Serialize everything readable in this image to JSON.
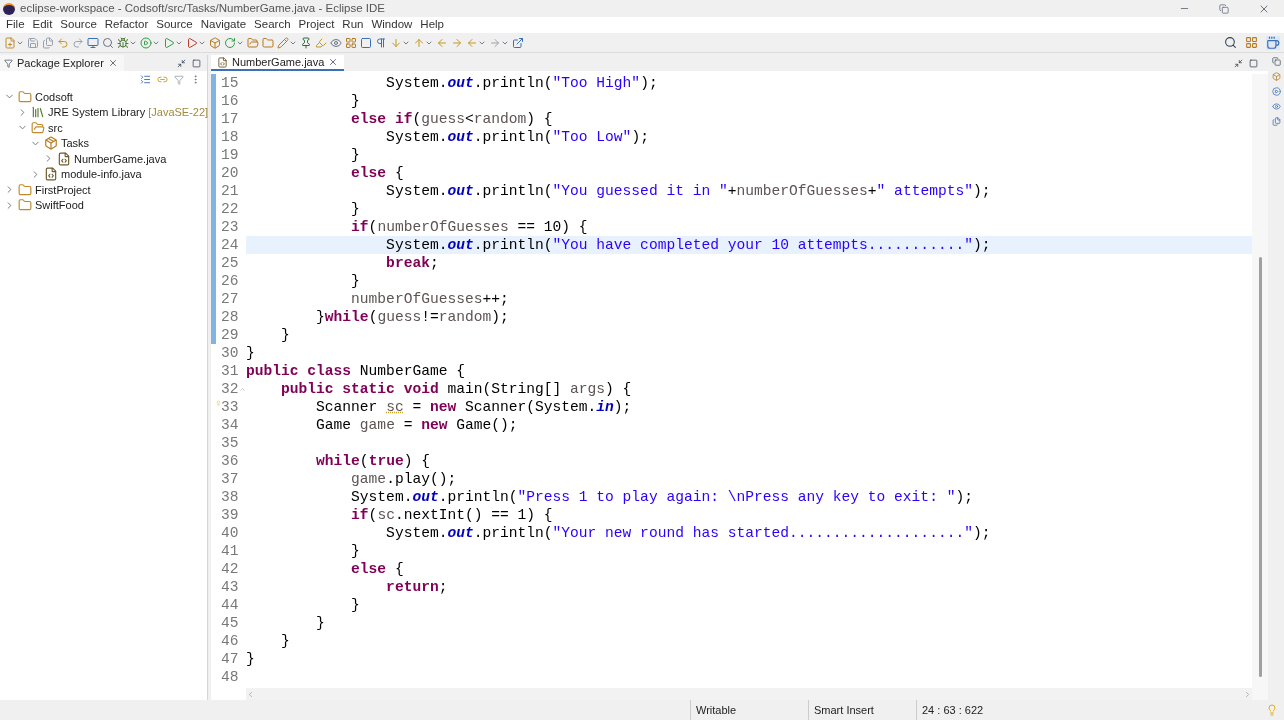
{
  "window": {
    "title": "eclipse-workspace - Codsoft/src/Tasks/NumberGame.java - Eclipse IDE"
  },
  "menu": [
    "File",
    "Edit",
    "Source",
    "Refactor",
    "Source",
    "Navigate",
    "Search",
    "Project",
    "Run",
    "Window",
    "Help"
  ],
  "explorer": {
    "title": "Package Explorer",
    "tree": [
      {
        "label": "Codsoft",
        "kind": "project",
        "expanded": true,
        "children": [
          {
            "label": "JRE System Library",
            "decoration": "[JavaSE-22]",
            "kind": "library",
            "expanded": false
          },
          {
            "label": "src",
            "kind": "folder",
            "expanded": true,
            "children": [
              {
                "label": "Tasks",
                "kind": "package",
                "expanded": true,
                "children": [
                  {
                    "label": "NumberGame.java",
                    "kind": "file",
                    "expanded": false
                  }
                ]
              },
              {
                "label": "module-info.java",
                "kind": "file",
                "expanded": false
              }
            ]
          }
        ]
      },
      {
        "label": "FirstProject",
        "kind": "project",
        "expanded": false
      },
      {
        "label": "SwiftFood",
        "kind": "project",
        "expanded": false
      }
    ]
  },
  "editor": {
    "tab": "NumberGame.java",
    "lines": [
      {
        "number": "15",
        "kind": "plain",
        "current": false,
        "range": true,
        "tokens": [
          {
            "kind": "plain",
            "text": "                System."
          },
          {
            "kind": "field",
            "text": "out"
          },
          {
            "kind": "plain",
            "text": ".println("
          },
          {
            "kind": "string",
            "text": "\"Too High\""
          },
          {
            "kind": "plain",
            "text": ");"
          }
        ]
      },
      {
        "number": "16",
        "kind": "plain",
        "current": false,
        "range": true,
        "tokens": [
          {
            "kind": "plain",
            "text": "            }"
          }
        ]
      },
      {
        "number": "17",
        "kind": "plain",
        "current": false,
        "range": true,
        "tokens": [
          {
            "kind": "keyword",
            "text": "            else if"
          },
          {
            "kind": "plain",
            "text": "("
          },
          {
            "kind": "local",
            "text": "guess"
          },
          {
            "kind": "plain",
            "text": "<"
          },
          {
            "kind": "local",
            "text": "random"
          },
          {
            "kind": "plain",
            "text": ") {"
          }
        ]
      },
      {
        "number": "18",
        "kind": "plain",
        "current": false,
        "range": true,
        "tokens": [
          {
            "kind": "plain",
            "text": "                System."
          },
          {
            "kind": "field",
            "text": "out"
          },
          {
            "kind": "plain",
            "text": ".println("
          },
          {
            "kind": "string",
            "text": "\"Too Low\""
          },
          {
            "kind": "plain",
            "text": ");"
          }
        ]
      },
      {
        "number": "19",
        "kind": "plain",
        "current": false,
        "range": true,
        "tokens": [
          {
            "kind": "plain",
            "text": "            }"
          }
        ]
      },
      {
        "number": "20",
        "kind": "plain",
        "current": false,
        "range": true,
        "tokens": [
          {
            "kind": "keyword",
            "text": "            else"
          },
          {
            "kind": "plain",
            "text": " {"
          }
        ]
      },
      {
        "number": "21",
        "kind": "plain",
        "current": false,
        "range": true,
        "tokens": [
          {
            "kind": "plain",
            "text": "                System."
          },
          {
            "kind": "field",
            "text": "out"
          },
          {
            "kind": "plain",
            "text": ".println("
          },
          {
            "kind": "string",
            "text": "\"You guessed it in \""
          },
          {
            "kind": "plain",
            "text": "+"
          },
          {
            "kind": "local",
            "text": "numberOfGuesses"
          },
          {
            "kind": "plain",
            "text": "+"
          },
          {
            "kind": "string",
            "text": "\" attempts\""
          },
          {
            "kind": "plain",
            "text": ");"
          }
        ]
      },
      {
        "number": "22",
        "kind": "plain",
        "current": false,
        "range": true,
        "tokens": [
          {
            "kind": "plain",
            "text": "            }"
          }
        ]
      },
      {
        "number": "23",
        "kind": "plain",
        "current": false,
        "range": true,
        "tokens": [
          {
            "kind": "keyword",
            "text": "            if"
          },
          {
            "kind": "plain",
            "text": "("
          },
          {
            "kind": "local",
            "text": "numberOfGuesses"
          },
          {
            "kind": "plain",
            "text": " == 10) {"
          }
        ]
      },
      {
        "number": "24",
        "kind": "plain",
        "current": true,
        "range": true,
        "tokens": [
          {
            "kind": "plain",
            "text": "                System."
          },
          {
            "kind": "field",
            "text": "out"
          },
          {
            "kind": "plain",
            "text": ".println("
          },
          {
            "kind": "string",
            "text": "\"You have completed your 10 attempts...........\""
          },
          {
            "kind": "plain",
            "text": ");"
          }
        ]
      },
      {
        "number": "25",
        "kind": "plain",
        "current": false,
        "range": true,
        "tokens": [
          {
            "kind": "keyword",
            "text": "                break"
          },
          {
            "kind": "plain",
            "text": ";"
          }
        ]
      },
      {
        "number": "26",
        "kind": "plain",
        "current": false,
        "range": true,
        "tokens": [
          {
            "kind": "plain",
            "text": "            }"
          }
        ]
      },
      {
        "number": "27",
        "kind": "plain",
        "current": false,
        "range": true,
        "tokens": [
          {
            "kind": "local",
            "text": "            numberOfGuesses"
          },
          {
            "kind": "plain",
            "text": "++;"
          }
        ]
      },
      {
        "number": "28",
        "kind": "plain",
        "current": false,
        "range": true,
        "tokens": [
          {
            "kind": "plain",
            "text": "        }"
          },
          {
            "kind": "keyword",
            "text": "while"
          },
          {
            "kind": "plain",
            "text": "("
          },
          {
            "kind": "local",
            "text": "guess"
          },
          {
            "kind": "plain",
            "text": "!="
          },
          {
            "kind": "local",
            "text": "random"
          },
          {
            "kind": "plain",
            "text": ");"
          }
        ]
      },
      {
        "number": "29",
        "kind": "plain",
        "current": false,
        "range": true,
        "tokens": [
          {
            "kind": "plain",
            "text": "    }"
          }
        ]
      },
      {
        "number": "30",
        "kind": "plain",
        "current": false,
        "range": false,
        "tokens": [
          {
            "kind": "plain",
            "text": "}"
          }
        ]
      },
      {
        "number": "31",
        "kind": "plain",
        "current": false,
        "range": false,
        "tokens": [
          {
            "kind": "keyword",
            "text": "public class"
          },
          {
            "kind": "plain",
            "text": " NumberGame {"
          }
        ]
      },
      {
        "number": "32",
        "kind": "fold",
        "current": false,
        "range": false,
        "tokens": [
          {
            "kind": "keyword",
            "text": "    public static void"
          },
          {
            "kind": "plain",
            "text": " main(String[] "
          },
          {
            "kind": "local",
            "text": "args"
          },
          {
            "kind": "plain",
            "text": ") {"
          }
        ]
      },
      {
        "number": "33",
        "kind": "warning",
        "current": false,
        "range": false,
        "tokens": [
          {
            "kind": "plain",
            "text": "        Scanner "
          },
          {
            "kind": "flagged",
            "text": "sc"
          },
          {
            "kind": "plain",
            "text": " = "
          },
          {
            "kind": "keyword",
            "text": "new"
          },
          {
            "kind": "plain",
            "text": " Scanner(System."
          },
          {
            "kind": "field",
            "text": "in"
          },
          {
            "kind": "plain",
            "text": ");"
          }
        ]
      },
      {
        "number": "34",
        "kind": "plain",
        "current": false,
        "range": false,
        "tokens": [
          {
            "kind": "plain",
            "text": "        Game "
          },
          {
            "kind": "local",
            "text": "game"
          },
          {
            "kind": "plain",
            "text": " = "
          },
          {
            "kind": "keyword",
            "text": "new"
          },
          {
            "kind": "plain",
            "text": " Game();"
          }
        ]
      },
      {
        "number": "35",
        "kind": "plain",
        "current": false,
        "range": false
      },
      {
        "number": "36",
        "kind": "plain",
        "current": false,
        "range": false,
        "tokens": [
          {
            "kind": "keyword",
            "text": "        while"
          },
          {
            "kind": "plain",
            "text": "("
          },
          {
            "kind": "keyword",
            "text": "true"
          },
          {
            "kind": "plain",
            "text": ") {"
          }
        ]
      },
      {
        "number": "37",
        "kind": "plain",
        "current": false,
        "range": false,
        "tokens": [
          {
            "kind": "local",
            "text": "            game"
          },
          {
            "kind": "plain",
            "text": ".play();"
          }
        ]
      },
      {
        "number": "38",
        "kind": "plain",
        "current": false,
        "range": false,
        "tokens": [
          {
            "kind": "plain",
            "text": "            System."
          },
          {
            "kind": "field",
            "text": "out"
          },
          {
            "kind": "plain",
            "text": ".println("
          },
          {
            "kind": "string",
            "text": "\"Press 1 to play again: \\nPress any key to exit: \""
          },
          {
            "kind": "plain",
            "text": ");"
          }
        ]
      },
      {
        "number": "39",
        "kind": "plain",
        "current": false,
        "range": false,
        "tokens": [
          {
            "kind": "keyword",
            "text": "            if"
          },
          {
            "kind": "plain",
            "text": "("
          },
          {
            "kind": "local",
            "text": "sc"
          },
          {
            "kind": "plain",
            "text": ".nextInt() == 1) {"
          }
        ]
      },
      {
        "number": "40",
        "kind": "plain",
        "current": false,
        "range": false,
        "tokens": [
          {
            "kind": "plain",
            "text": "                System."
          },
          {
            "kind": "field",
            "text": "out"
          },
          {
            "kind": "plain",
            "text": ".println("
          },
          {
            "kind": "string",
            "text": "\"Your new round has started....................\""
          },
          {
            "kind": "plain",
            "text": ");"
          }
        ]
      },
      {
        "number": "41",
        "kind": "plain",
        "current": false,
        "range": false,
        "tokens": [
          {
            "kind": "plain",
            "text": "            }"
          }
        ]
      },
      {
        "number": "42",
        "kind": "plain",
        "current": false,
        "range": false,
        "tokens": [
          {
            "kind": "keyword",
            "text": "            else"
          },
          {
            "kind": "plain",
            "text": " {"
          }
        ]
      },
      {
        "number": "43",
        "kind": "plain",
        "current": false,
        "range": false,
        "tokens": [
          {
            "kind": "keyword",
            "text": "                return"
          },
          {
            "kind": "plain",
            "text": ";"
          }
        ]
      },
      {
        "number": "44",
        "kind": "plain",
        "current": false,
        "range": false,
        "tokens": [
          {
            "kind": "plain",
            "text": "            }"
          }
        ]
      },
      {
        "number": "45",
        "kind": "plain",
        "current": false,
        "range": false,
        "tokens": [
          {
            "kind": "plain",
            "text": "        }"
          }
        ]
      },
      {
        "number": "46",
        "kind": "plain",
        "current": false,
        "range": false,
        "tokens": [
          {
            "kind": "plain",
            "text": "    }"
          }
        ]
      },
      {
        "number": "47",
        "kind": "plain",
        "current": false,
        "range": false,
        "tokens": [
          {
            "kind": "plain",
            "text": "}"
          }
        ]
      },
      {
        "number": "48",
        "kind": "plain",
        "current": false,
        "range": false
      }
    ]
  },
  "status_bar": {
    "mode": "Writable",
    "insert": "Smart Insert",
    "position": "24 : 63 : 622"
  }
}
